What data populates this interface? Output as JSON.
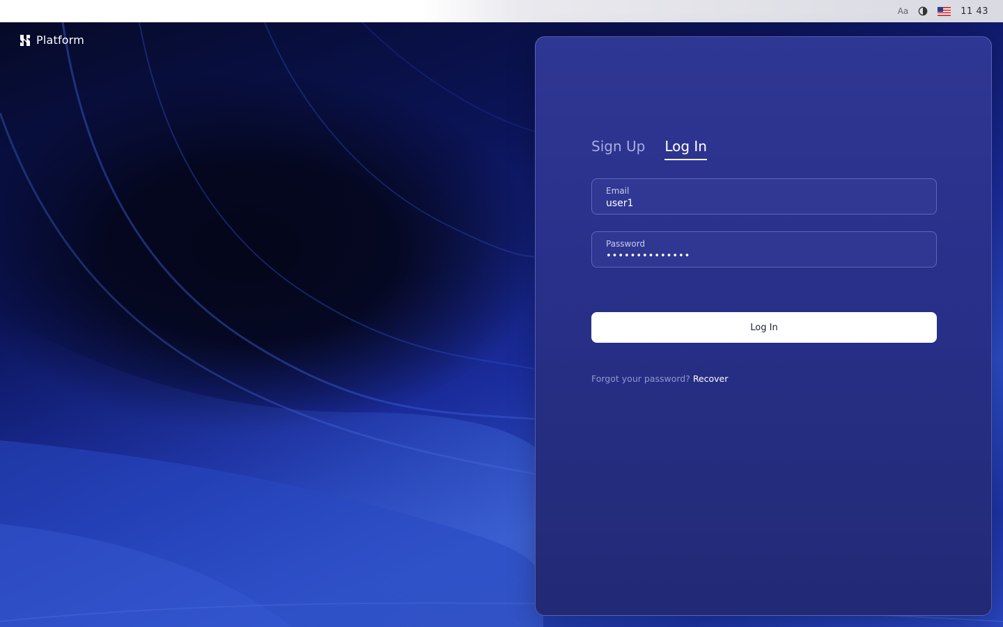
{
  "topbar": {
    "font_toggle": "Aa",
    "contrast_icon": "contrast-icon",
    "flag_icon": "us-flag-icon",
    "clock": "11 43"
  },
  "brand": {
    "logo_icon": "platform-logo-icon",
    "name": "Platform"
  },
  "auth": {
    "tabs": [
      {
        "label": "Sign Up",
        "active": false
      },
      {
        "label": "Log In",
        "active": true
      }
    ],
    "email": {
      "label": "Email",
      "value": "user1"
    },
    "password": {
      "label": "Password",
      "value": "••••••••••••••"
    },
    "submit_label": "Log In",
    "forgot_text": "Forgot your password?",
    "recover_link": "Recover"
  },
  "colors": {
    "card_bg": "#2a3288",
    "button_bg": "#ffffff",
    "accent_text": "#ffffff"
  }
}
